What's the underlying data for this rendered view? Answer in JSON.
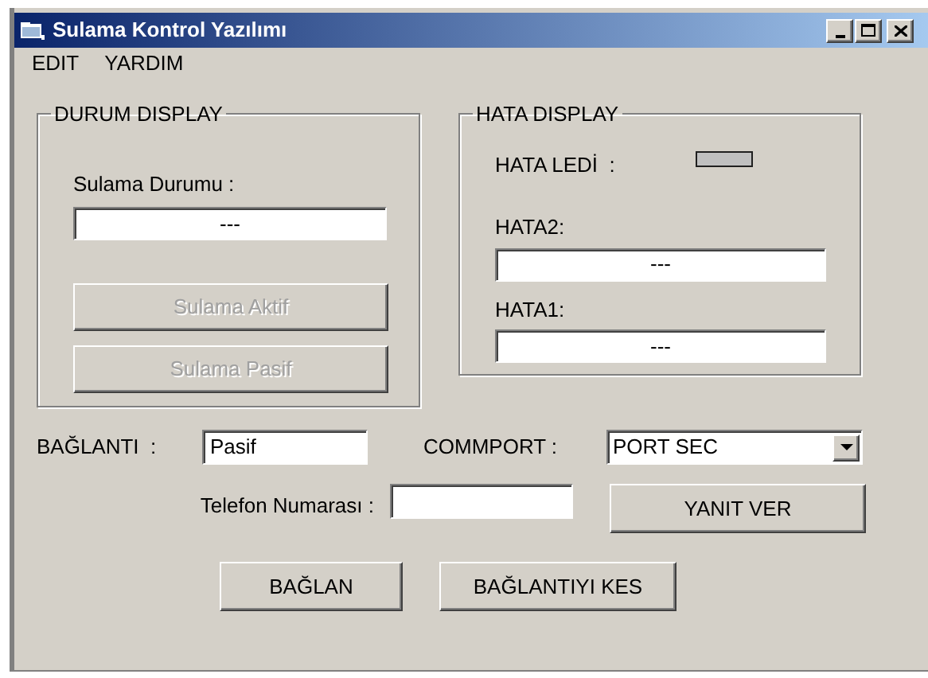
{
  "window": {
    "title": "Sulama Kontrol Yazılımı"
  },
  "menu": [
    "EDIT",
    "YARDIM"
  ],
  "durum_display": {
    "title": "DURUM DISPLAY",
    "status_label": "Sulama Durumu :",
    "status_value": "---",
    "buttons": [
      {
        "label": "Sulama Aktif",
        "disabled": true
      },
      {
        "label": "Sulama Pasif",
        "disabled": true
      }
    ]
  },
  "hata_display": {
    "title": "HATA DISPLAY",
    "led_label": "HATA LEDİ  :",
    "led_on": false,
    "fields": [
      {
        "label": "HATA2:",
        "value": "---"
      },
      {
        "label": "HATA1:",
        "value": "---"
      }
    ]
  },
  "connection": {
    "label": "BAĞLANTI  :",
    "value": "Pasif"
  },
  "commport": {
    "label": "COMMPORT :",
    "value": "PORT SEC"
  },
  "phone": {
    "label": "Telefon Numarası :"
  },
  "answer_button": "YANIT VER",
  "buttons": [
    "BAĞLAN",
    "BAĞLANTIYI KES"
  ]
}
